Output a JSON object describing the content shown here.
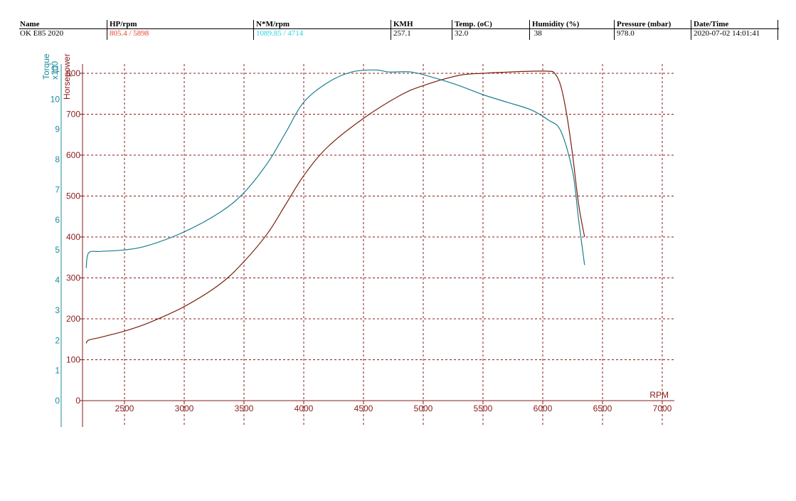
{
  "header": {
    "columns": [
      {
        "label": "Name",
        "value": "OK E85 2020",
        "color": "#000000"
      },
      {
        "label": "HP/rpm",
        "value": "805.4 / 5898",
        "color": "#e8432a"
      },
      {
        "label": "N*M/rpm",
        "value": "1089.85 / 4714",
        "color": "#21d4e6"
      },
      {
        "label": "KMH",
        "value": "257.1",
        "color": "#000000"
      },
      {
        "label": "Temp. (oC)",
        "value": "32.0",
        "color": "#000000"
      },
      {
        "label": "Humidity (%)",
        "value": " 38",
        "color": "#000000"
      },
      {
        "label": "Pressure (mbar)",
        "value": "978.0",
        "color": "#000000"
      },
      {
        "label": "Date/Time",
        "value": "2020-07-02 14:01:41",
        "color": "#000000"
      }
    ]
  },
  "chart_data": {
    "type": "line",
    "xlabel": "RPM",
    "ylabel_hp": "Horsepower",
    "ylabel_torque": "Torque",
    "torque_scale_label": "x100",
    "xlim": [
      2180,
      7100
    ],
    "ylim_hp": [
      0,
      800
    ],
    "ylim_torque": [
      0,
      11
    ],
    "x_ticks": [
      2500,
      3000,
      3500,
      4000,
      4500,
      5000,
      5500,
      6000,
      6500,
      7000
    ],
    "hp_ticks": [
      0,
      100,
      200,
      300,
      400,
      500,
      600,
      700,
      800
    ],
    "torque_ticks": [
      0,
      1,
      2,
      3,
      4,
      5,
      6,
      7,
      8,
      9,
      10,
      11
    ],
    "grid": true,
    "colors": {
      "hp_axis": "#8b1a1a",
      "torque_axis": "#1a8c9c",
      "grid": "#8b1a1a",
      "background": "#ffffff"
    },
    "series": [
      {
        "name": "Horsepower",
        "axis": "hp",
        "color": "#7a1f0f",
        "x": [
          2180,
          2200,
          2300,
          2500,
          2700,
          3000,
          3300,
          3500,
          3700,
          3850,
          4000,
          4200,
          4500,
          4800,
          5000,
          5300,
          5500,
          5700,
          5900,
          6050,
          6100,
          6150,
          6200,
          6250,
          6300,
          6350
        ],
        "y": [
          140,
          148,
          155,
          170,
          190,
          230,
          285,
          340,
          410,
          480,
          550,
          620,
          690,
          745,
          770,
          795,
          800,
          803,
          805,
          805,
          800,
          770,
          700,
          600,
          480,
          400
        ]
      },
      {
        "name": "Torque",
        "axis": "torque",
        "color": "#1a7f8f",
        "x": [
          2180,
          2200,
          2300,
          2500,
          2700,
          3000,
          3300,
          3500,
          3700,
          3850,
          4000,
          4200,
          4400,
          4600,
          4714,
          4900,
          5100,
          5300,
          5500,
          5700,
          5900,
          6050,
          6150,
          6250,
          6300,
          6350
        ],
        "y": [
          4.4,
          4.9,
          4.95,
          5.0,
          5.15,
          5.6,
          6.25,
          6.9,
          7.9,
          8.9,
          9.9,
          10.55,
          10.9,
          10.97,
          10.9,
          10.9,
          10.7,
          10.45,
          10.15,
          9.9,
          9.65,
          9.3,
          8.95,
          7.6,
          6.0,
          4.5
        ]
      }
    ]
  }
}
